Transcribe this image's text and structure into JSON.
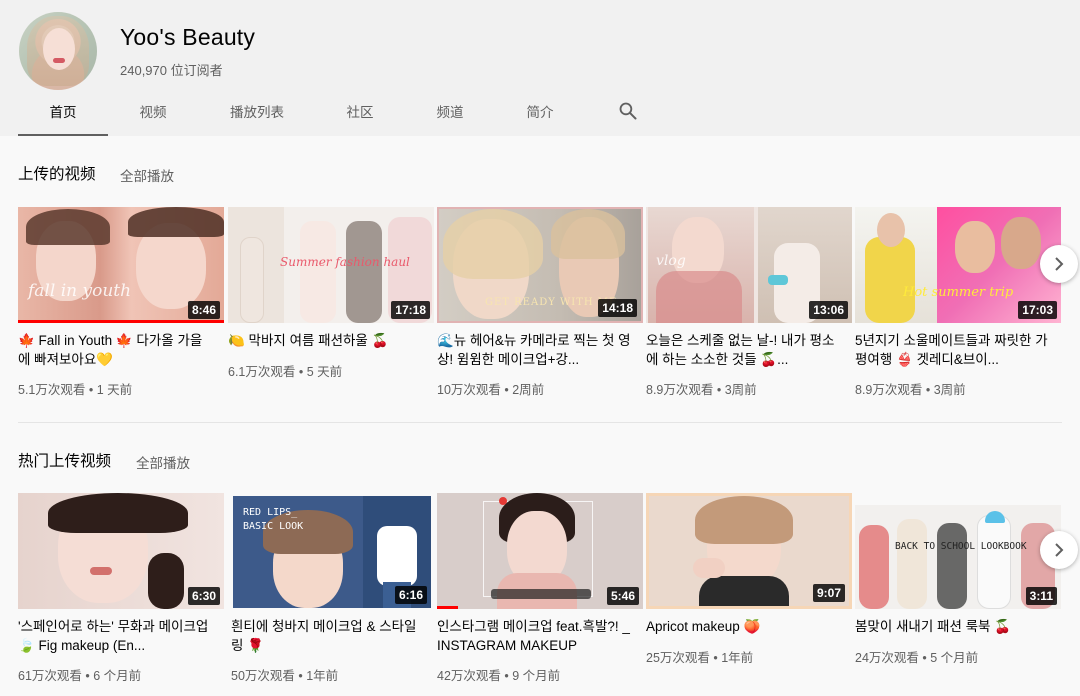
{
  "channel": {
    "name": "Yoo's Beauty",
    "subscribers": "240,970 位订阅者"
  },
  "tabs": [
    {
      "label": "首页",
      "active": true
    },
    {
      "label": "视频"
    },
    {
      "label": "播放列表"
    },
    {
      "label": "社区"
    },
    {
      "label": "频道"
    },
    {
      "label": "简介"
    }
  ],
  "sections": [
    {
      "title": "上传的视频",
      "play_all": "全部播放",
      "videos": [
        {
          "title": "🍁 Fall in Youth 🍁 다가올 가을에 빠져보아요💛",
          "views": "5.1万次观看",
          "age": "1 天前",
          "duration": "8:46",
          "thumb_text": "fall in youth",
          "progress": 1.0
        },
        {
          "title": "🍋 막바지 여름 패션하울 🍒",
          "views": "6.1万次观看",
          "age": "5 天前",
          "duration": "17:18",
          "thumb_text": "Summer fashion haul"
        },
        {
          "title": "🌊뉴 헤어&뉴 카메라로 찍는 첫 영상! 윔윔한 메이크업+강...",
          "views": "10万次观看",
          "age": "2周前",
          "duration": "14:18",
          "thumb_text": "GET READY WITH ME"
        },
        {
          "title": "오늘은 스케줄 없는 날-! 내가 평소에 하는 소소한 것들 🍒...",
          "views": "8.9万次观看",
          "age": "3周前",
          "duration": "13:06",
          "thumb_text": "vlog"
        },
        {
          "title": "5년지기 소울메이트들과 짜릿한 가평여행 👙 겟레디&브이...",
          "views": "8.9万次观看",
          "age": "3周前",
          "duration": "17:03",
          "thumb_text": "Hot summer trip"
        }
      ]
    },
    {
      "title": "热门上传视频",
      "play_all": "全部播放",
      "videos": [
        {
          "title": "'스페인어로 하는' 무화과 메이크업 🍃 Fig makeup (En...",
          "views": "61万次观看",
          "age": "6 个月前",
          "duration": "6:30"
        },
        {
          "title": "흰티에 청바지 메이크업 & 스타일링 🌹",
          "views": "50万次观看",
          "age": "1年前",
          "duration": "6:16",
          "thumb_text": "RED LIPS_ BASIC LOOK"
        },
        {
          "title": "인스타그램 메이크업 feat.흑발?! _ INSTAGRAM MAKEUP",
          "views": "42万次观看",
          "age": "9 个月前",
          "duration": "5:46",
          "progress": 0.1
        },
        {
          "title": "Apricot makeup 🍑",
          "views": "25万次观看",
          "age": "1年前",
          "duration": "9:07"
        },
        {
          "title": "봄맞이 새내기 패션 룩북 🍒",
          "views": "24万次观看",
          "age": "5 个月前",
          "duration": "3:11",
          "thumb_text": "BACK TO SCHOOL LOOKBOOK"
        }
      ]
    }
  ],
  "icons": {
    "search": "search-icon",
    "next": "chevron-right-icon"
  },
  "colors": {
    "progress": "#ff0000",
    "header_bg": "#f1f1f1",
    "page_bg": "#f9f9f9"
  }
}
